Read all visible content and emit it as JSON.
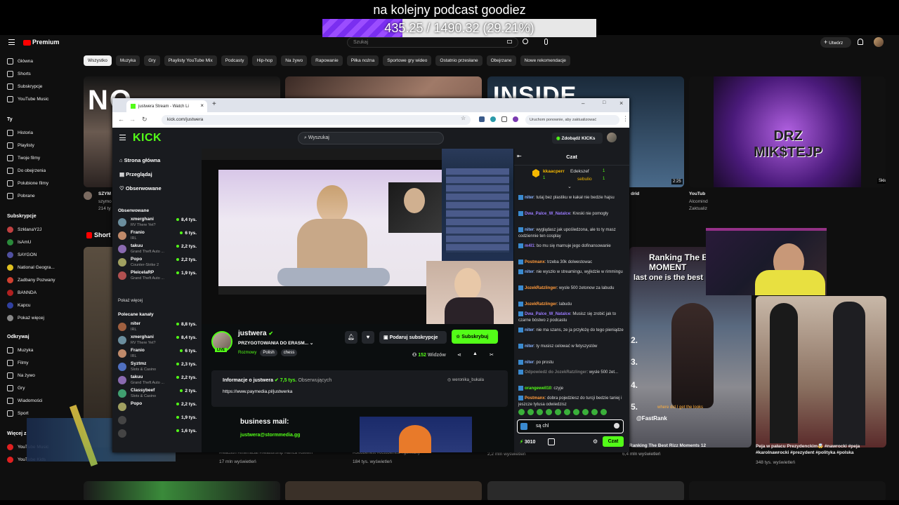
{
  "overlay": {
    "title": "na kolejny podcast goodiez",
    "goal_text": "435.25 / 1490.32 (29.21%)",
    "goal_fraction": 0.2921
  },
  "yt": {
    "logo": "Premium",
    "search_placeholder": "Szukaj",
    "create": "Utwórz",
    "chips": [
      "Wszystko",
      "Muzyka",
      "Gry",
      "Playlisty YouTube Mix",
      "Podcasty",
      "Hip-hop",
      "Na żywo",
      "Rapowanie",
      "Piłka nożna",
      "Sportowe gry wideo",
      "Ostatnio przesłane",
      "Obejrzane",
      "Nowe rekomendacje"
    ],
    "side_main": [
      "Główna",
      "Shorts",
      "Subskrypcje",
      "YouTube Music"
    ],
    "side_you_title": "Ty",
    "side_you": [
      "Historia",
      "Playlisty",
      "Twoje filmy",
      "Do obejrzenia",
      "Polubione filmy",
      "Pobrane"
    ],
    "side_subs_title": "Subskrypcje",
    "side_subs": [
      "SzklanaY2J",
      "IsAmU",
      "SAYGON",
      "National Geogra...",
      "Zadbany Pozwany",
      "BANNDA",
      "Kapcu",
      "Pokaż więcej"
    ],
    "side_explore_title": "Odkrywaj",
    "side_explore": [
      "Muzyka",
      "Filmy",
      "Na żywo",
      "Gry",
      "Wiadomości",
      "Sport"
    ],
    "side_more_title": "Więcej z",
    "side_more": [
      "YouTube Music",
      "YouTube Kids"
    ],
    "shorts_label": "Short",
    "cards": [
      {
        "title": "SZYM",
        "meta": "szymo",
        "meta2": "214 ty"
      },
      {
        "title": "drid",
        "meta": "",
        "meta2": ""
      },
      {
        "title": "YouTub",
        "meta": "Alcomind",
        "meta2": "Zaktualiz"
      },
      {
        "duration": "2:25",
        "channel": "Składanka"
      }
    ],
    "shorts": [
      {
        "title": "Ranking The Best Rizz Moments 12",
        "meta": "6,4 mln wyświetleń",
        "caption": "Ranking The Best RIZZ MOMENT",
        "caption2": "last one is the best",
        "nums": [
          "2.",
          "3.",
          "4.",
          "5."
        ],
        "tag": "@FastRank",
        "sub": "where did I get the looks"
      },
      {
        "title": "Peja w pałacu Prezydenckim🤯 #nawrocki #peja #karolnawrocki #prezydent #polityka #polska",
        "meta": "348 tys. wyświetleń"
      }
    ],
    "row2_meta": [
      "17 mln wyświetleń",
      "184 tys. wyświetleń",
      "2,2 mln wyświetleń"
    ],
    "row2_tags": [
      "#reaction #interracial #relationship #africa #bwwm",
      "#oktoberfest #octoberfest #germany"
    ]
  },
  "browser": {
    "tab_title": "justwera Stream - Watch Li",
    "url": "kick.com/justwera",
    "update": "Uruchom ponownie, aby zaktualizować"
  },
  "kick": {
    "search": "Wyszukaj",
    "kicks_button": "Zdobądź KICKs",
    "nav": [
      "Strona główna",
      "Przeglądaj",
      "Obserwowane"
    ],
    "followed_title": "Obserwowane",
    "followed": [
      {
        "name": "xmerghani",
        "game": "RV There Yet?",
        "viewers": "8,4 tys.",
        "color": "#6b8e9e"
      },
      {
        "name": "Franio",
        "game": "IRL",
        "viewers": "6 tys.",
        "color": "#c08a6a"
      },
      {
        "name": "takuu",
        "game": "Grand Theft Auto ...",
        "viewers": "2,2 tys.",
        "color": "#8a6ab0"
      },
      {
        "name": "Popo",
        "game": "Counter-Strike 2",
        "viewers": "2,2 tys.",
        "color": "#a0a060"
      },
      {
        "name": "PleiceIaRP",
        "game": "Grand Theft Auto ...",
        "viewers": "1,9 tys.",
        "color": "#b05050"
      }
    ],
    "show_more": "Pokaż więcej",
    "rec_title": "Polecane kanały",
    "rec": [
      {
        "name": "niter",
        "game": "IRL",
        "viewers": "8,8 tys.",
        "color": "#a06040"
      },
      {
        "name": "xmerghani",
        "game": "RV There Yet?",
        "viewers": "8,4 tys.",
        "color": "#6b8e9e"
      },
      {
        "name": "Franio",
        "game": "IRL",
        "viewers": "6 tys.",
        "color": "#c08a6a"
      },
      {
        "name": "Syztmz",
        "game": "Slots & Casino",
        "viewers": "2,3 tys.",
        "color": "#5070c0"
      },
      {
        "name": "takuu",
        "game": "Grand Theft Auto ...",
        "viewers": "2,2 tys.",
        "color": "#8a6ab0"
      },
      {
        "name": "Classybeef",
        "game": "Slots & Casino",
        "viewers": "2 tys.",
        "color": "#40a070"
      },
      {
        "name": "Popo",
        "game": "",
        "viewers": "2,2 tys.",
        "color": "#a0a060"
      },
      {
        "name": "",
        "game": "",
        "viewers": "1,9 tys.",
        "color": "#444"
      },
      {
        "name": "",
        "game": "",
        "viewers": "1,6 tys.",
        "color": "#444"
      }
    ],
    "streamer": {
      "name": "justwera",
      "title": "PRZYGOTOWANIA DO ERASM...",
      "category": "Rozmowy",
      "tags": [
        "Polish",
        "chess"
      ],
      "live": "LIVE",
      "viewers": "152",
      "viewers_label": "Widzów"
    },
    "sub_gift": "Podaruj subskrypcje",
    "subscribe": "Subskrybuj",
    "about_title": "Informacje o justwera",
    "followers": "7,5 tys.",
    "followers_label": "Obserwujących",
    "about_link": "https://www.paymedia.pl/justwerka",
    "social": "weronika_bukala",
    "business_title": "business mail:",
    "business_mail": "justwera@stormmedia.gg",
    "chat": {
      "title": "Czat",
      "top": [
        {
          "name": "kkaacperr",
          "n": "1"
        },
        {
          "name": "Edekszef",
          "n": "1"
        },
        {
          "name": "sebulio",
          "n": "1"
        }
      ],
      "messages": [
        {
          "user": "niter",
          "text": "tutaj bez plastiku w kakał nie bedzie hajsu",
          "color": "#8ab4ff"
        },
        {
          "user": "Dwa_Palce_W_Natalce",
          "text": "Kreski nie pomogły",
          "color": "#9b7bff"
        },
        {
          "user": "niter",
          "text": "wyglądasz jak upośledzona, ale to ty masz codziennie ten cosplay",
          "color": "#8ab4ff"
        },
        {
          "user": "m4l1",
          "text": "bo mu się marnuje jego dofinansowanie",
          "color": "#9b7bff"
        },
        {
          "user": "Postmanx",
          "text": "trzeba 30k dolwestowac",
          "color": "#ff9a3c"
        },
        {
          "user": "niter",
          "text": "nie wyszło w streamingu, wyjkdzie w rimmingu",
          "color": "#8ab4ff"
        },
        {
          "user": "JozekRatzlinger",
          "text": "wysle 500 żetonow za labudu",
          "color": "#ff9a3c"
        },
        {
          "user": "JozekRatzlinger",
          "text": "labudu",
          "color": "#ff9a3c"
        },
        {
          "user": "Dwa_Palce_W_Natalce",
          "text": "Musisz się zrobić jak to czarne bóstwo z podcastu",
          "color": "#9b7bff"
        },
        {
          "user": "niter",
          "text": "nie ma szans, ze ja przyłożę do tego pieniądze",
          "color": "#8ab4ff"
        },
        {
          "user": "niter",
          "text": "ty musisz celować w fetyszystów",
          "color": "#8ab4ff"
        },
        {
          "user": "niter",
          "text": "po prostu",
          "color": "#8ab4ff"
        },
        {
          "user": "Odpowiedź do JozekRatzlinger",
          "text": "wysle 500 żet...",
          "color": "#777"
        },
        {
          "user": "orangewell10",
          "text": "czyje",
          "color": "#53fc18"
        },
        {
          "user": "Postmanx",
          "text": "dobra pojedziesz do turcji bedzie taniej i jeszcze tytusa odwiedzisz",
          "color": "#ff9a3c"
        }
      ],
      "input": "są chl",
      "points": "3010",
      "send": "Czat"
    }
  }
}
